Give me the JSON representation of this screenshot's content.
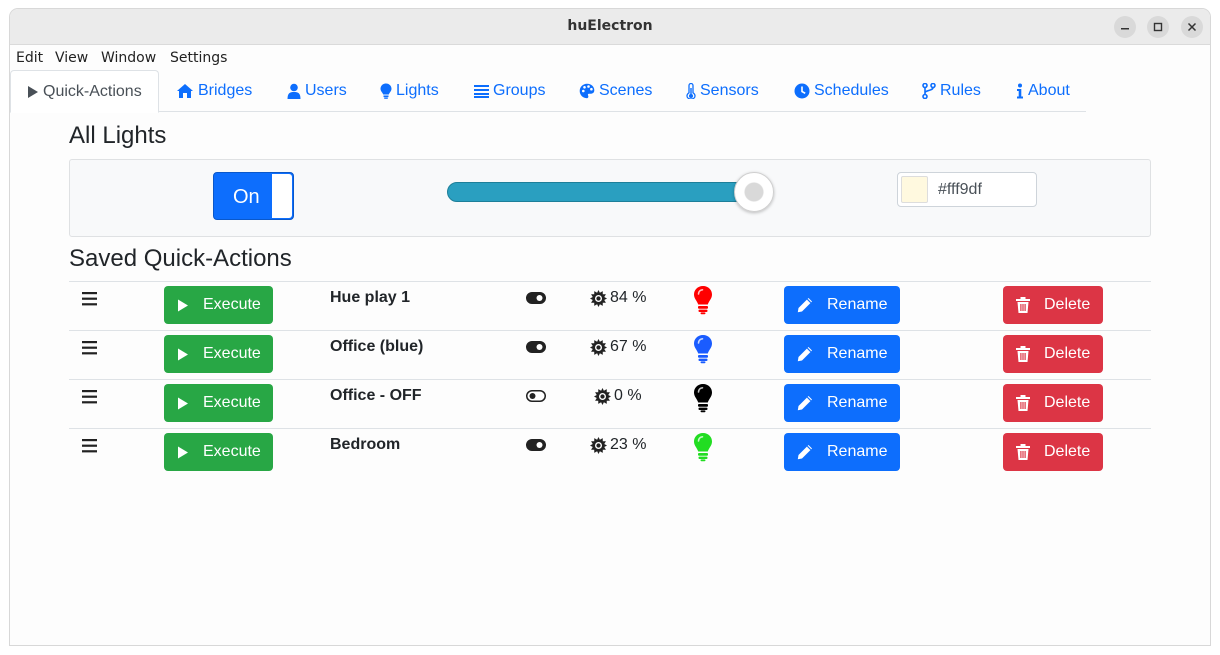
{
  "window": {
    "title": "huElectron"
  },
  "menu": [
    "Edit",
    "View",
    "Window",
    "Settings"
  ],
  "tabs": [
    {
      "label": "Quick-Actions",
      "icon": "play-icon",
      "active": true
    },
    {
      "label": "Bridges",
      "icon": "home-icon"
    },
    {
      "label": "Users",
      "icon": "user-icon"
    },
    {
      "label": "Lights",
      "icon": "lightbulb-icon"
    },
    {
      "label": "Groups",
      "icon": "list-icon"
    },
    {
      "label": "Scenes",
      "icon": "palette-icon"
    },
    {
      "label": "Sensors",
      "icon": "thermometer-icon"
    },
    {
      "label": "Schedules",
      "icon": "clock-icon"
    },
    {
      "label": "Rules",
      "icon": "branch-icon"
    },
    {
      "label": "About",
      "icon": "info-icon"
    }
  ],
  "all_lights": {
    "heading": "All Lights",
    "power_label": "On",
    "brightness": 0.94,
    "color_hex": "#fff9df"
  },
  "saved": {
    "heading": "Saved Quick-Actions",
    "execute_label": "Execute",
    "rename_label": "Rename",
    "delete_label": "Delete",
    "items": [
      {
        "name": "Hue play 1",
        "on": true,
        "brightness": "84 %",
        "bulb_color": "#ff0000"
      },
      {
        "name": "Office (blue)",
        "on": true,
        "brightness": "67 %",
        "bulb_color": "#1a5cff"
      },
      {
        "name": "Office - OFF",
        "on": false,
        "brightness": "0 %",
        "bulb_color": "#000000"
      },
      {
        "name": "Bedroom",
        "on": true,
        "brightness": "23 %",
        "bulb_color": "#22dd22"
      }
    ]
  },
  "colors": {
    "primary": "#0d6efd",
    "success": "#28a745",
    "danger": "#dc3545",
    "slider": "#2a9fc0"
  }
}
